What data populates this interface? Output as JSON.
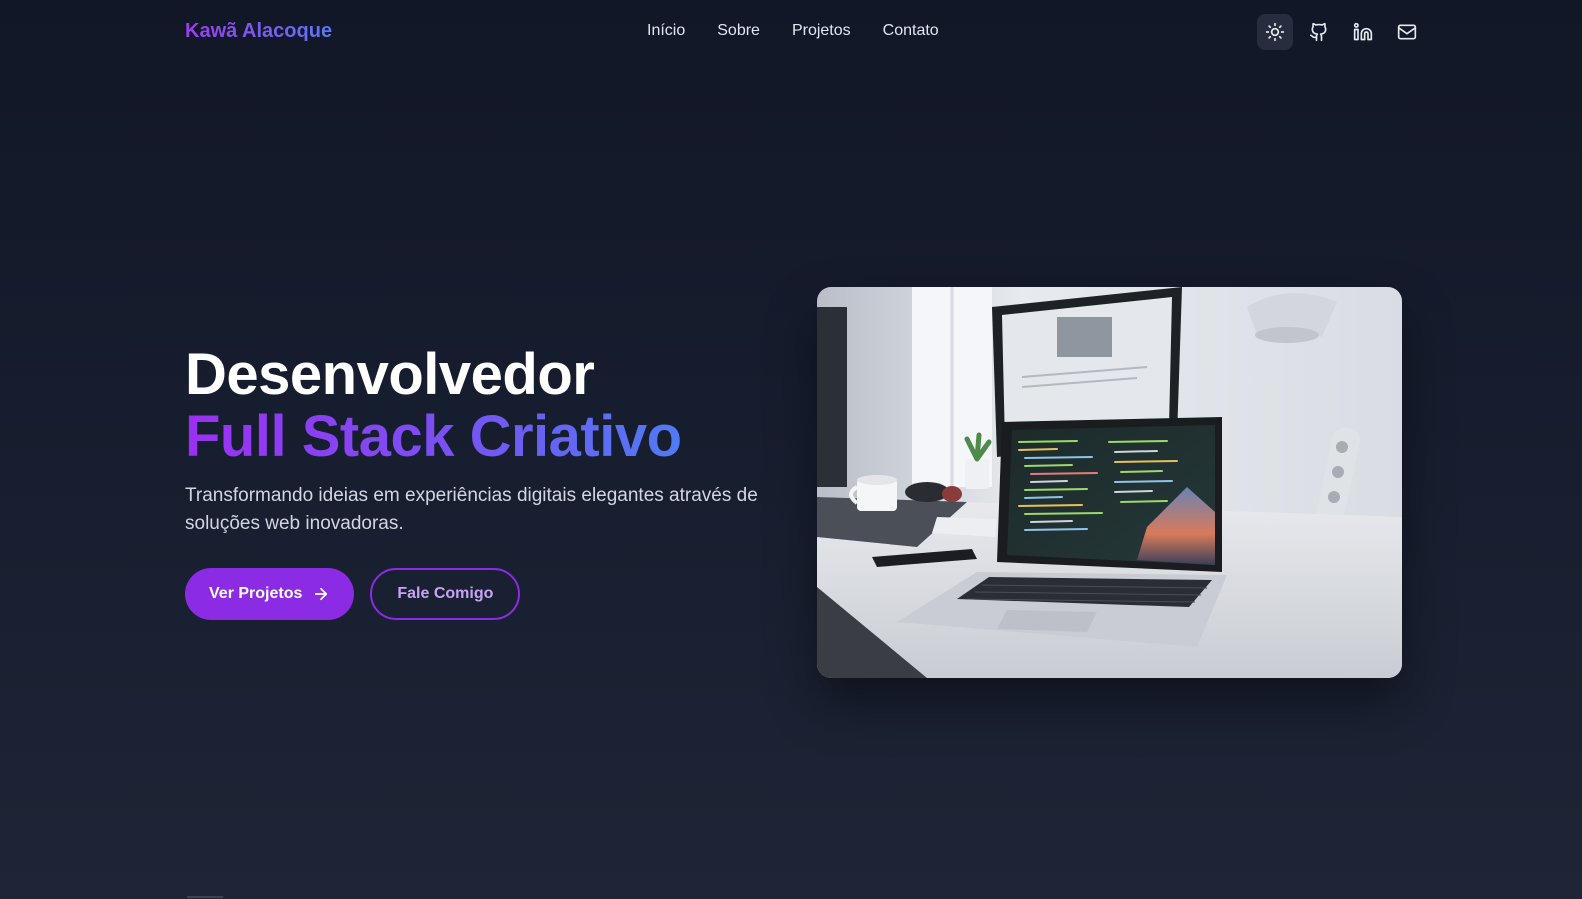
{
  "navbar": {
    "logo": "Kawã Alacoque",
    "links": [
      {
        "label": "Início"
      },
      {
        "label": "Sobre"
      },
      {
        "label": "Projetos"
      },
      {
        "label": "Contato"
      }
    ],
    "actions": [
      {
        "icon": "sun-icon",
        "active": true
      },
      {
        "icon": "github-icon"
      },
      {
        "icon": "linkedin-icon"
      },
      {
        "icon": "mail-icon"
      }
    ]
  },
  "hero": {
    "headline_line1": "Desenvolvedor",
    "headline_line2": "Full Stack Criativo",
    "subtitle": "Transformando ideias em experiências digitais elegantes através de soluções web inovadoras.",
    "primary_button": "Ver Projetos",
    "secondary_button": "Fale Comigo"
  },
  "colors": {
    "background": "#131a2a",
    "accent_purple": "#8b2be3",
    "accent_blue": "#4f7bf2"
  }
}
